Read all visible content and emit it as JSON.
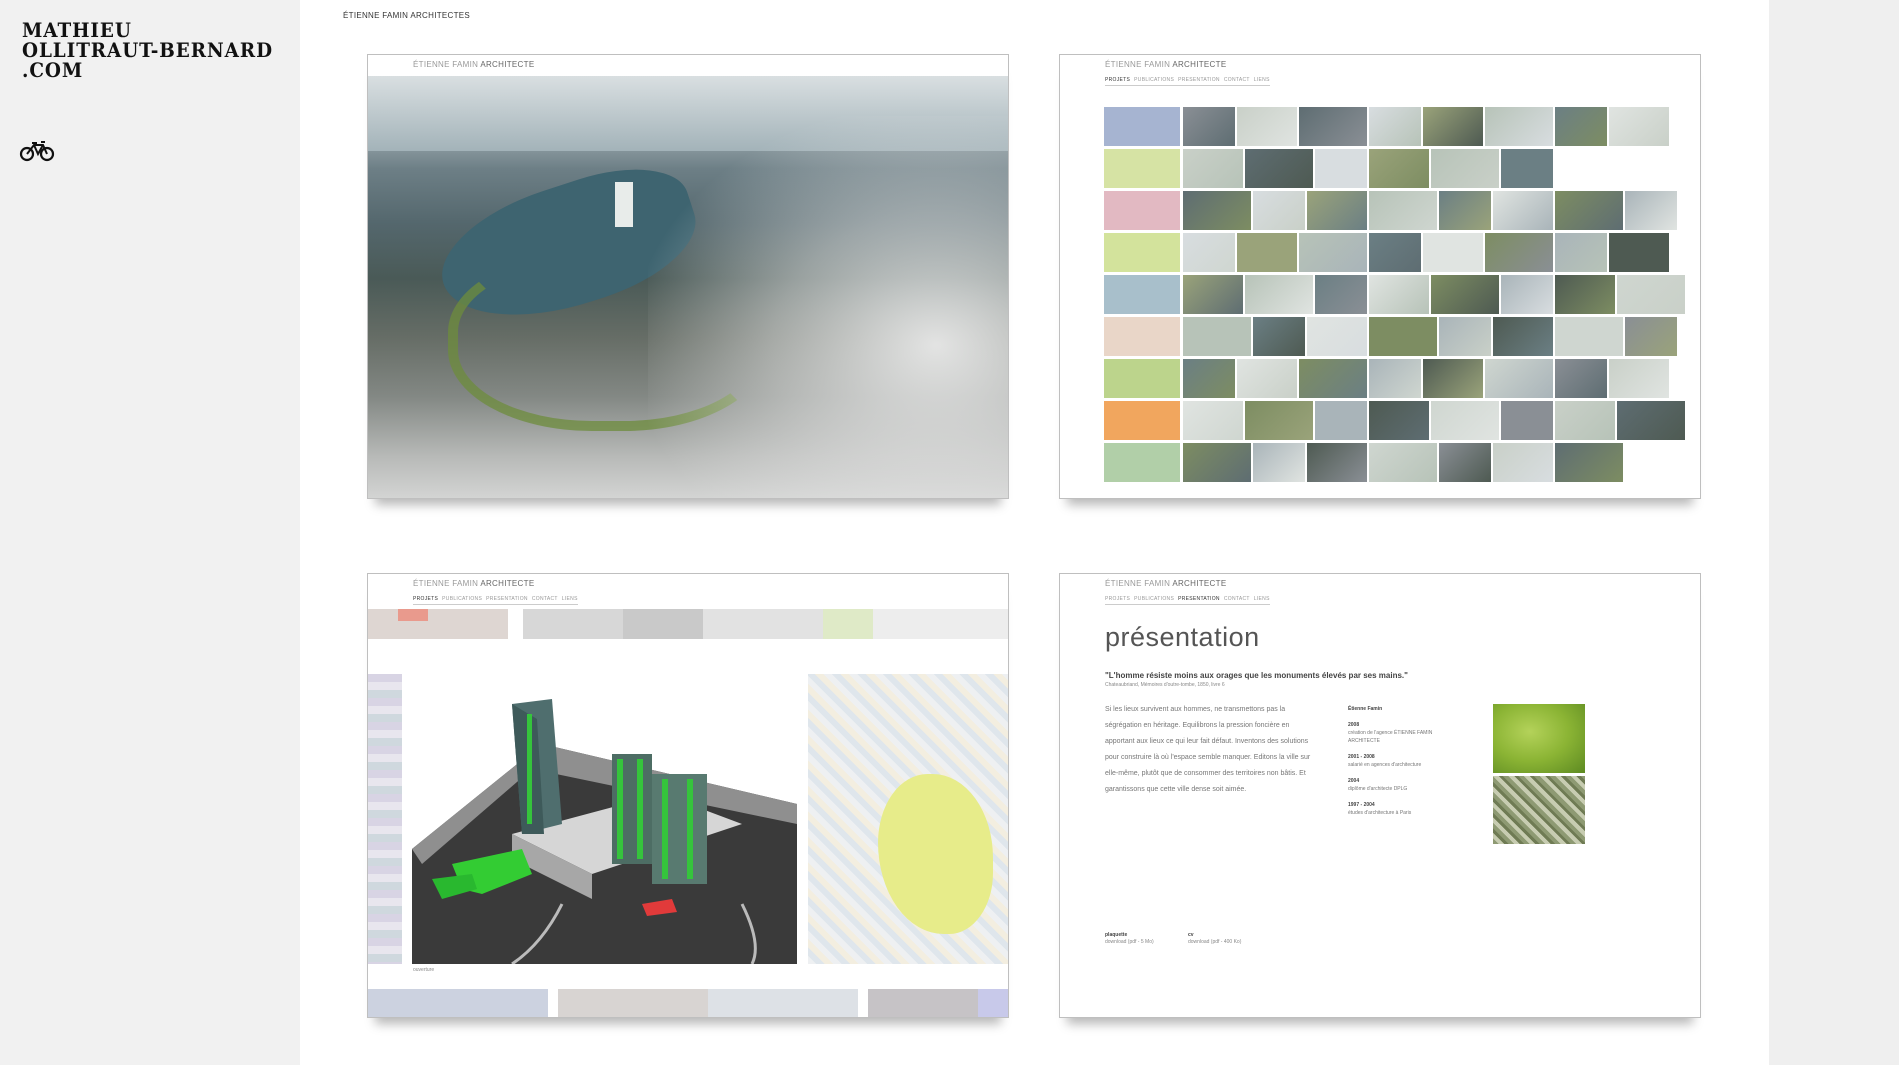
{
  "site": {
    "logo_lines": [
      "MATHIEU",
      "OLLITRAUT-BERNARD",
      ".COM"
    ],
    "bike_icon": "bicycle-icon"
  },
  "header": {
    "label": "ÉTIENNE FAMIN ARCHITECTES"
  },
  "cards": {
    "brand_light": "ÉTIENNE FAMIN",
    "brand_bold": "ARCHITECTE",
    "nav": [
      "PROJETS",
      "PUBLICATIONS",
      "PRESENTATION",
      "CONTACT",
      "LIENS"
    ]
  },
  "grid": {
    "swatch_colors": [
      "#a6b4d1",
      "#d6e3a4",
      "#e2b9c2",
      "#d3e39c",
      "#a8bfcb",
      "#e9d6c8",
      "#bcd48c",
      "#f1a65e",
      "#b1cfa8"
    ]
  },
  "model": {
    "caption": "ouverture"
  },
  "presentation": {
    "title": "présentation",
    "quote": "\"L'homme résiste moins aux orages que les monuments élevés par ses mains.\"",
    "quote_source": "Chateaubriand, Mémoires d'outre-tombe, 1850, livre 6",
    "paragraph": "Si les lieux survivent aux hommes, ne transmettons pas la ségrégation en héritage. Equilibrons la pression foncière en apportant aux lieux ce qui leur fait défaut. Inventons des solutions pour construire là où l'espace semble manquer. Editons la ville sur elle-même, plutôt que de consommer des territoires non bâtis. Et garantissons que cette ville dense soit aimée.",
    "cv_name": "Étienne Famin",
    "cv": [
      {
        "year": "2008",
        "text": "création de l'agence ÉTIENNE FAMIN ARCHITECTE"
      },
      {
        "year": "2001 - 2008",
        "text": "salarié en agences d'architecture"
      },
      {
        "year": "2004",
        "text": "diplôme d'architecte DPLG"
      },
      {
        "year": "1997 - 2004",
        "text": "études d'architecture à Paris"
      }
    ],
    "download1_title": "plaquette",
    "download1_text": "download (pdf - 5 Mo)",
    "download2_title": "cv",
    "download2_text": "download (pdf - 400 Ko)"
  }
}
